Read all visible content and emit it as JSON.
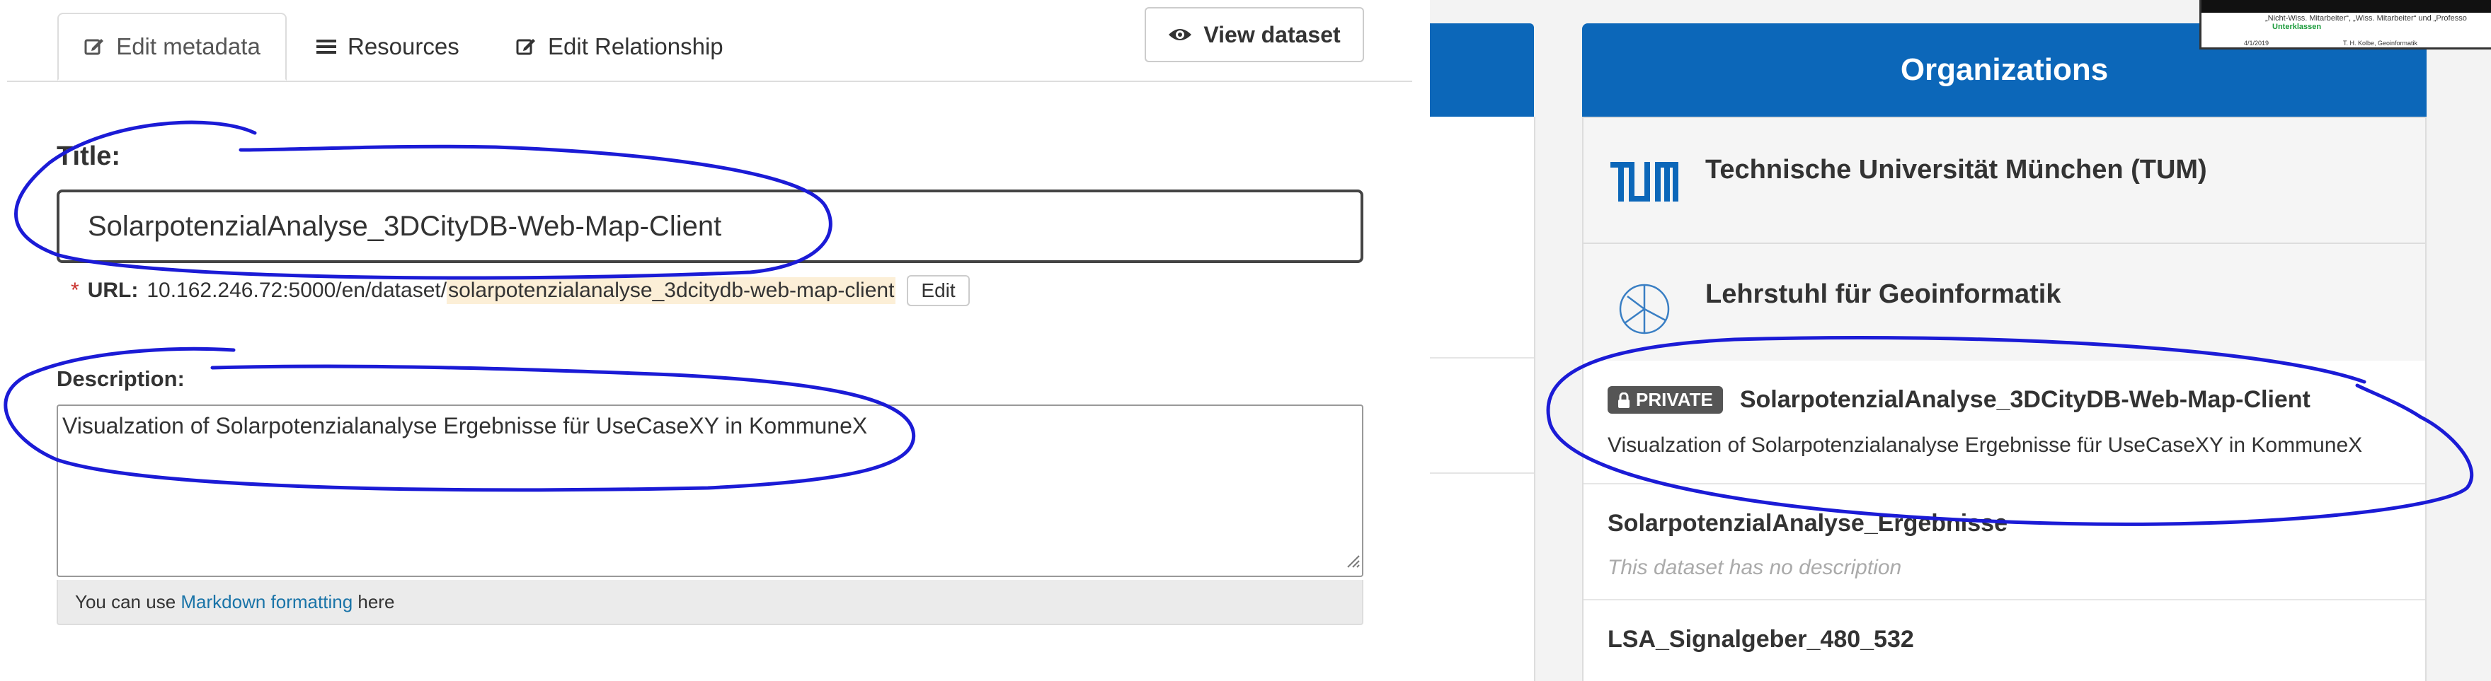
{
  "tabs": {
    "edit_metadata": "Edit metadata",
    "resources": "Resources",
    "edit_relationship": "Edit Relationship"
  },
  "view_dataset_label": "View dataset",
  "form": {
    "title_label": "Title:",
    "title_value": "SolarpotenzialAnalyse_3DCityDB-Web-Map-Client",
    "url_required_marker": "*",
    "url_label": "URL:",
    "url_prefix": "10.162.246.72:5000/en/dataset/",
    "url_slug": "solarpotenzialanalyse_3dcitydb-web-map-client",
    "url_edit_label": "Edit",
    "description_label": "Description:",
    "description_value": "Visualzation of Solarpotenzialanalyse Ergebnisse für UseCaseXY in KommuneX",
    "help_prefix": "You can use ",
    "help_link": "Markdown formatting",
    "help_suffix": " here"
  },
  "organizations": {
    "header": "Organizations",
    "items": [
      {
        "name": "Technische Universität München (TUM)",
        "logo": "tum-logo"
      },
      {
        "name": "Lehrstuhl für Geoinformatik",
        "logo": "geoinformatik-logo"
      }
    ]
  },
  "datasets": [
    {
      "badge": "PRIVATE",
      "title": "SolarpotenzialAnalyse_3DCityDB-Web-Map-Client",
      "description": "Visualzation of Solarpotenzialanalyse Ergebnisse für UseCaseXY in KommuneX"
    },
    {
      "badge": "",
      "title": "SolarpotenzialAnalyse_Ergebnisse",
      "description": "This dataset has no description"
    },
    {
      "badge": "",
      "title": "LSA_Signalgeber_480_532",
      "description": ""
    }
  ],
  "thumbnail": {
    "line1": "„Nicht-Wiss. Mitarbeiter“, „Wiss. Mitarbeiter“ und „Professo",
    "line2": "Unterklassen",
    "footer_left": "4/1/2019",
    "footer_right": "T. H. Kolbe, Geoinformatik"
  },
  "colors": {
    "brand_blue": "#0c67b9",
    "annotation_ink": "#1b1bd6",
    "link": "#1a74a8",
    "slug_highlight": "#fcefd7",
    "badge_bg": "#555555"
  }
}
